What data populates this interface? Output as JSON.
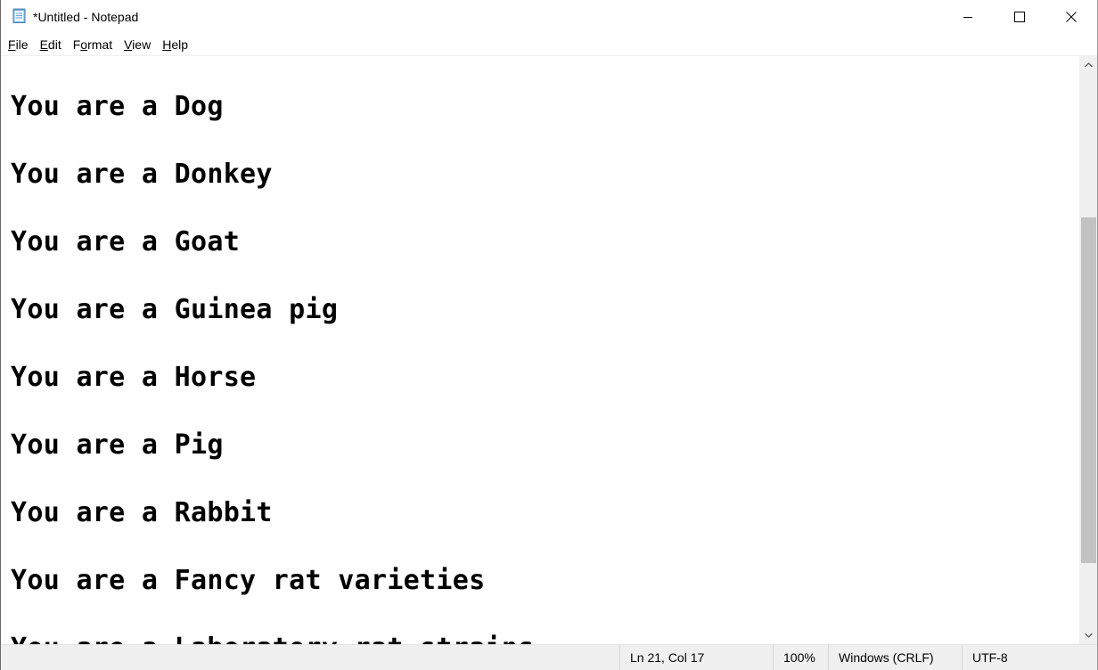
{
  "window": {
    "title": "*Untitled - Notepad",
    "icon": "notepad-icon"
  },
  "caption_buttons": {
    "minimize": "minimize-icon",
    "maximize": "maximize-icon",
    "close": "close-icon"
  },
  "menu": {
    "items": [
      {
        "mnemonic": "F",
        "rest": "ile"
      },
      {
        "mnemonic": "E",
        "rest": "dit"
      },
      {
        "pre": "F",
        "mnemonic": "o",
        "rest": "rmat"
      },
      {
        "mnemonic": "V",
        "rest": "iew"
      },
      {
        "mnemonic": "H",
        "rest": "elp"
      }
    ]
  },
  "editor": {
    "lines": [
      "You are a Dog",
      "You are a Donkey",
      "You are a Goat",
      "You are a Guinea pig",
      "You are a Horse",
      "You are a Pig",
      "You are a Rabbit",
      "You are a Fancy rat varieties",
      "You are a Laboratory rat strains"
    ]
  },
  "scrollbar": {
    "up": "scroll-up-arrow-icon",
    "down": "scroll-down-arrow-icon"
  },
  "status": {
    "position": "Ln 21, Col 17",
    "zoom": "100%",
    "line_ending": "Windows (CRLF)",
    "encoding": "UTF-8"
  },
  "colors": {
    "statusbar_bg": "#f0f0f0",
    "scrollbar_thumb": "#c2c2c2",
    "text": "#000000"
  }
}
